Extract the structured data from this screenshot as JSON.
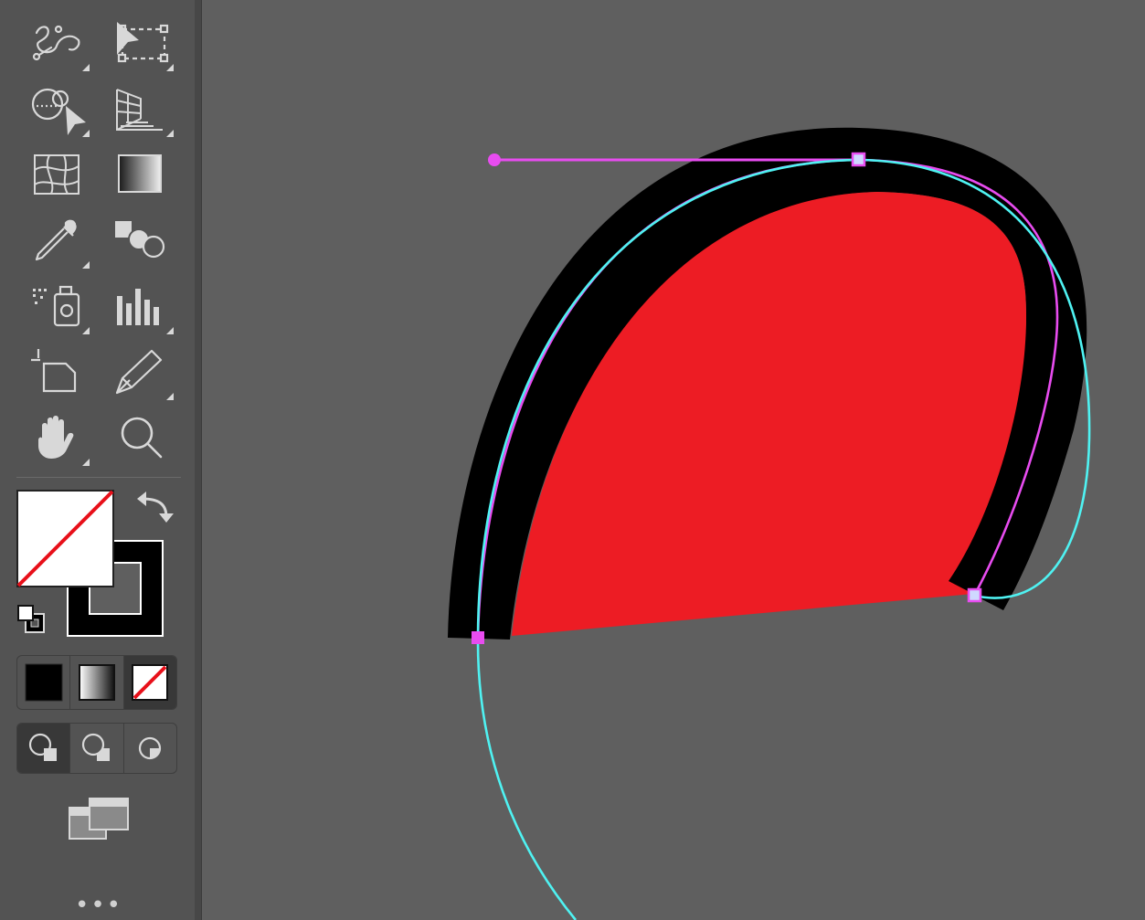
{
  "app": {
    "colors": {
      "toolbar_bg": "#535353",
      "canvas_bg": "#5f5f5f",
      "icon": "#d8d8d8",
      "shape_fill": "#ed1c24",
      "shape_stroke": "#000000",
      "path_magenta": "#e84cf0",
      "path_cyan": "#4ff2f2",
      "none_slash": "#e8101a"
    }
  },
  "toolbar": {
    "tools": [
      {
        "id": "puppet-warp",
        "icon": "puppet-warp-icon"
      },
      {
        "id": "free-transform",
        "icon": "free-transform-icon"
      },
      {
        "id": "shape-builder",
        "icon": "shape-builder-icon"
      },
      {
        "id": "perspective-grid",
        "icon": "perspective-grid-icon"
      },
      {
        "id": "mesh",
        "icon": "mesh-icon"
      },
      {
        "id": "gradient",
        "icon": "gradient-icon"
      },
      {
        "id": "eyedropper",
        "icon": "eyedropper-icon"
      },
      {
        "id": "blend",
        "icon": "blend-icon"
      },
      {
        "id": "symbol-sprayer",
        "icon": "symbol-sprayer-icon"
      },
      {
        "id": "column-graph",
        "icon": "column-graph-icon"
      },
      {
        "id": "artboard",
        "icon": "artboard-icon"
      },
      {
        "id": "slice",
        "icon": "slice-icon"
      },
      {
        "id": "hand",
        "icon": "hand-icon"
      },
      {
        "id": "zoom",
        "icon": "zoom-icon"
      }
    ],
    "fill": {
      "state": "none"
    },
    "stroke": {
      "color": "#000000"
    },
    "color_modes": [
      "color",
      "gradient",
      "none"
    ],
    "draw_modes": [
      "draw-normal",
      "draw-behind",
      "draw-inside"
    ],
    "more_label": "•••"
  }
}
